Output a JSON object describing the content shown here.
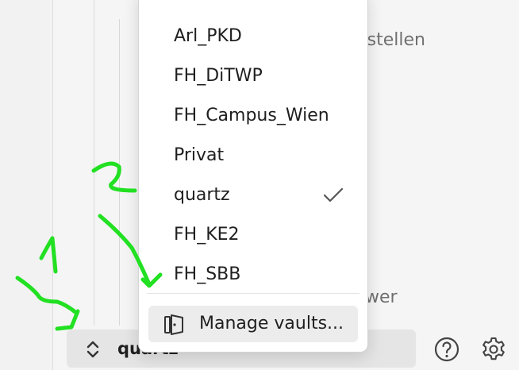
{
  "background": {
    "partial_text_top": "tstellen",
    "partial_text_bottom": "wer"
  },
  "vault_menu": {
    "items": [
      {
        "label": "Arl_PKD",
        "selected": false
      },
      {
        "label": "FH_DiTWP",
        "selected": false
      },
      {
        "label": "FH_Campus_Wien",
        "selected": false
      },
      {
        "label": "Privat",
        "selected": false
      },
      {
        "label": "quartz",
        "selected": true
      },
      {
        "label": "FH_KE2",
        "selected": false
      },
      {
        "label": "FH_SBB",
        "selected": false
      }
    ],
    "manage_label": "Manage vaults..."
  },
  "vault_switcher": {
    "name": "quartz"
  },
  "icons": {
    "help": "help-circle-icon",
    "settings": "gear-icon",
    "switcher": "chevrons-up-down-icon",
    "manage": "vault-door-icon",
    "selected": "checkmark-icon"
  },
  "annotations": {
    "labels": [
      "1",
      "2"
    ],
    "color": "#22e022"
  }
}
